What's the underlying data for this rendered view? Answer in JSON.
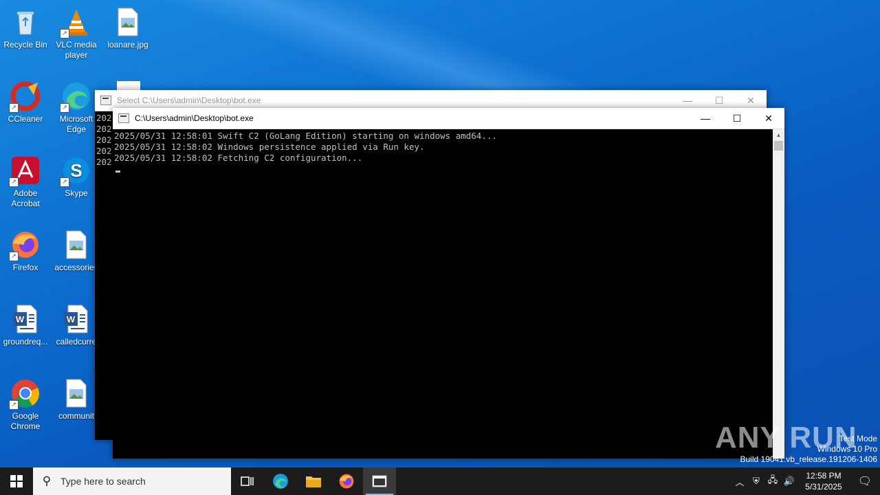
{
  "desktop": {
    "icons": [
      {
        "label": "Recycle Bin",
        "icon": "recycle-bin-icon"
      },
      {
        "label": "VLC media player",
        "icon": "vlc-icon"
      },
      {
        "label": "loanare.jpg",
        "icon": "image-file-icon"
      },
      {
        "label": "CCleaner",
        "icon": "ccleaner-icon"
      },
      {
        "label": "Microsoft Edge",
        "icon": "edge-icon"
      },
      {
        "label": "Adobe Acrobat",
        "icon": "acrobat-icon"
      },
      {
        "label": "Skype",
        "icon": "skype-icon"
      },
      {
        "label": "Firefox",
        "icon": "firefox-icon"
      },
      {
        "label": "accessories",
        "icon": "image-file-icon"
      },
      {
        "label": "groundreq...",
        "icon": "word-doc-icon"
      },
      {
        "label": "calledcurre",
        "icon": "word-doc-icon"
      },
      {
        "label": "Google Chrome",
        "icon": "chrome-icon"
      },
      {
        "label": "communit",
        "icon": "image-file-icon"
      }
    ]
  },
  "back_window": {
    "title": "Select C:\\Users\\admin\\Desktop\\bot.exe",
    "lines": [
      "202",
      "202",
      "202",
      "202",
      "202"
    ]
  },
  "front_window": {
    "title": "C:\\Users\\admin\\Desktop\\bot.exe",
    "lines": [
      "2025/05/31 12:58:01 Swift C2 (GoLang Edition) starting on windows amd64...",
      "2025/05/31 12:58:02 Windows persistence applied via Run key.",
      "2025/05/31 12:58:02 Fetching C2 configuration..."
    ]
  },
  "taskbar": {
    "search_placeholder": "Type here to search",
    "time": "12:58 PM",
    "date": "5/31/2025"
  },
  "watermark": {
    "line1": "Test Mode",
    "line2": "Windows 10 Pro",
    "line3": "Build 19041.vb_release.191206-1406",
    "brand": "ANY RUN"
  },
  "colors": {
    "accent": "#0a64c8",
    "taskbar": "#1c1c1c"
  }
}
